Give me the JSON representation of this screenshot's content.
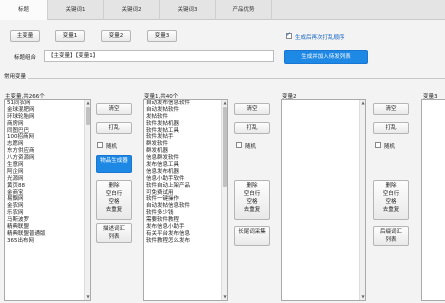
{
  "tabs": [
    "标题",
    "关键词1",
    "关键词2",
    "关键词3",
    "产品优势"
  ],
  "top_buttons": [
    "主变量",
    "变量1",
    "变量2",
    "变量3"
  ],
  "combo": {
    "label": "标题组合",
    "value": "【主变量】【变量1】"
  },
  "shuffle_checkbox": {
    "label": "生成后再次打乱顺序",
    "checked": true
  },
  "generate_button": "生成并加入待发列表",
  "group_title": "常用变量",
  "columns": [
    {
      "header": "主变量,共266个",
      "items": [
        "51同农网",
        "金球混肥网",
        "环球轮胎网",
        "商房网",
        "同图巴巴",
        "100招商网",
        "志愿网",
        "东方供应商",
        "八方资源网",
        "生意网",
        "阿企网",
        "光源网",
        "黄页88",
        "金商宝",
        "易飘网",
        "金农网",
        "乐农网",
        "马斯波罗",
        "精典联盟",
        "精典联盟普通版",
        "365出布网"
      ],
      "buttons": [
        "清空",
        "打乱",
        "随机",
        "物品生成器",
        "删除\n空白行\n空格\n去重复",
        "描述词汇\n列表"
      ]
    },
    {
      "header": "变量1,共40个",
      "items": [
        "自动发布信息软件",
        "自动发帖软件",
        "发帖软件",
        "软件发帖机器",
        "软件发帖工具",
        "软件发帖手",
        "群发软件",
        "群发机器",
        "信息群发软件",
        "发布信息工具",
        "信息发布机器",
        "信息小助手软件",
        "软件自动上架产品",
        "可免费试用",
        "软件一键操作",
        "自动发帖信息软件",
        "软件多少钱",
        "需要软件教程",
        "发布信息小助手",
        "有关平台发布信息",
        "软件教程怎么发布"
      ],
      "buttons": [
        "清空",
        "打乱",
        "随机",
        "删除\n空白行\n空格\n去重复",
        "长尾词采集"
      ]
    },
    {
      "header": "变量2",
      "items": [],
      "buttons": [
        "清空",
        "打乱",
        "随机",
        "删除\n空白行\n空格\n去重复",
        "后缀词汇\n列表"
      ]
    },
    {
      "header": "变量3",
      "items": [],
      "buttons": []
    }
  ]
}
